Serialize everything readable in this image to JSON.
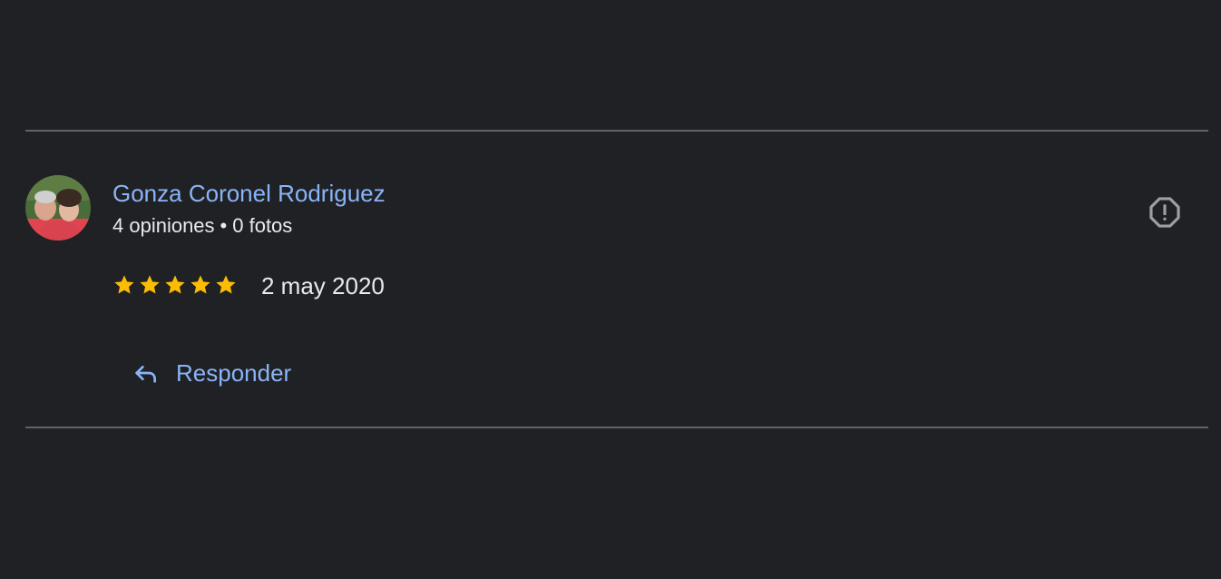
{
  "review": {
    "reviewer_name": "Gonza Coronel Rodriguez",
    "reviews_count": "4 opiniones",
    "separator": "•",
    "photos_count": "0 fotos",
    "rating": 5,
    "rating_max": 5,
    "date": "2 may 2020",
    "reply_label": "Responder"
  },
  "icons": {
    "report": "report-flag-icon",
    "reply": "reply-arrow-icon",
    "star": "star-icon"
  },
  "colors": {
    "background": "#202124",
    "link": "#8ab4f8",
    "text": "#e8eaed",
    "star": "#fbbc04",
    "divider": "#5f6368",
    "icon": "#9aa0a6"
  }
}
